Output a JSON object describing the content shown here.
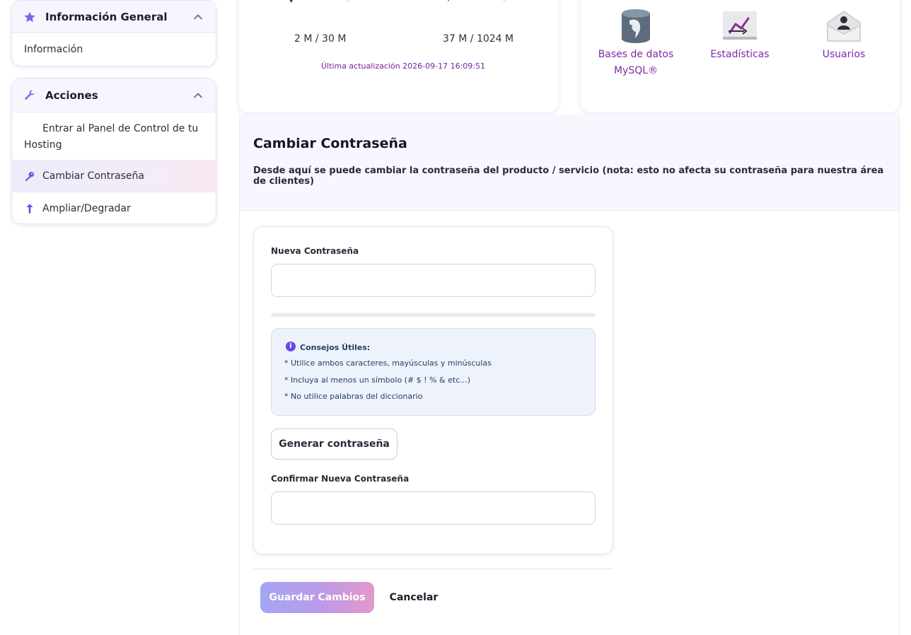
{
  "sidebar": {
    "general": {
      "title": "Información General",
      "icon": "star-icon",
      "items": [
        {
          "label": "Información"
        }
      ]
    },
    "actions": {
      "title": "Acciones",
      "icon": "wrench-icon",
      "items": [
        {
          "label": "Entrar al Panel de Control de tu Hosting",
          "icon": ""
        },
        {
          "label": "Cambiar Contraseña",
          "icon": "key-icon",
          "active": true
        },
        {
          "label": "Ampliar/Degradar",
          "icon": "arrow-up-icon"
        }
      ]
    }
  },
  "usage": {
    "disk": {
      "label": "2 M / 30 M"
    },
    "bandwidth": {
      "label": "37 M / 1024 M"
    },
    "last_update": "Última actualización 2026-09-17 16:09:51"
  },
  "quick_links": [
    {
      "label_line1": "Bases de datos",
      "label_line2": "MySQL®",
      "icon": "mysql-database-icon"
    },
    {
      "label_line1": "Estadísticas",
      "label_line2": "",
      "icon": "statistics-chart-icon"
    },
    {
      "label_line1": "Usuarios",
      "label_line2": "",
      "icon": "user-envelope-icon"
    }
  ],
  "change_password": {
    "title": "Cambiar Contraseña",
    "description": "Desde aquí se puede cambiar la contraseña del producto / servicio (nota: esto no afecta su contraseña para nuestra área de clientes)",
    "new_password_label": "Nueva Contraseña",
    "new_password_value": "",
    "tips_title": "Consejos Útiles:",
    "tips_icon": "info-icon",
    "tips": [
      "* Utilice ambos caracteres, mayúsculas y minúsculas",
      "* Incluya al menos un símbolo (# $ ! % & etc...)",
      "* No utilice palabras del diccionario"
    ],
    "generate_button": "Generar contraseña",
    "confirm_label": "Confirmar Nueva Contraseña",
    "confirm_value": "",
    "save_button": "Guardar Cambios",
    "cancel_button": "Cancelar"
  },
  "colors": {
    "accent": "#7b2ba6",
    "icon_purple": "#7a66e8",
    "active_bg": "#efebfb",
    "tips_bg": "#eef3fb"
  }
}
